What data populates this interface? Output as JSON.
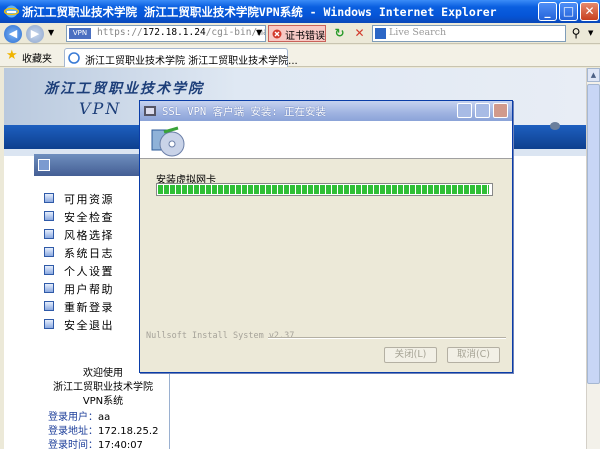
{
  "window": {
    "title": "浙江工贸职业技术学院 浙江工贸职业技术学院VPN系统 - Windows Internet Explorer",
    "controls": {
      "minimize": "_",
      "maximize": "□",
      "close": "✕"
    }
  },
  "address_bar": {
    "scheme": "https://",
    "host": "172.18.1.24",
    "path": "/cgi-bin/main.cgi?",
    "cert_error": "证书错误",
    "search_placeholder": "Live Search"
  },
  "favorites": {
    "label": "收藏夹",
    "tab_title": "浙江工贸职业技术学院 浙江工贸职业技术学院..."
  },
  "page": {
    "banner_title": "浙江工贸职业技术学院",
    "banner_vpn": "VPN",
    "menu": [
      {
        "label": "可用资源"
      },
      {
        "label": "安全检查"
      },
      {
        "label": "风格选择"
      },
      {
        "label": "系统日志"
      },
      {
        "label": "个人设置"
      },
      {
        "label": "用户帮助"
      },
      {
        "label": "重新登录"
      },
      {
        "label": "安全退出"
      }
    ],
    "welcome": {
      "line1": "欢迎使用",
      "line2": "浙江工贸职业技术学院",
      "line3": "VPN系统"
    },
    "login": {
      "user_label": "登录用户：",
      "user_value": "aa",
      "addr_label": "登录地址：",
      "addr_value": "172.18.25.2",
      "time_label": "登录时间：",
      "time_value": "17:40:07"
    }
  },
  "dialog": {
    "title": "SSL VPN 客户端 安装: 正在安装",
    "status": "安装虚拟网卡",
    "progress": 1.0,
    "nsis": "Nullsoft Install System v2.37",
    "close_label": "关闭(L)",
    "cancel_label": "取消(C)"
  },
  "colors": {
    "titlebar": "#0554d6",
    "progress": "#2fbf36",
    "banner_text": "#1c3e79"
  }
}
